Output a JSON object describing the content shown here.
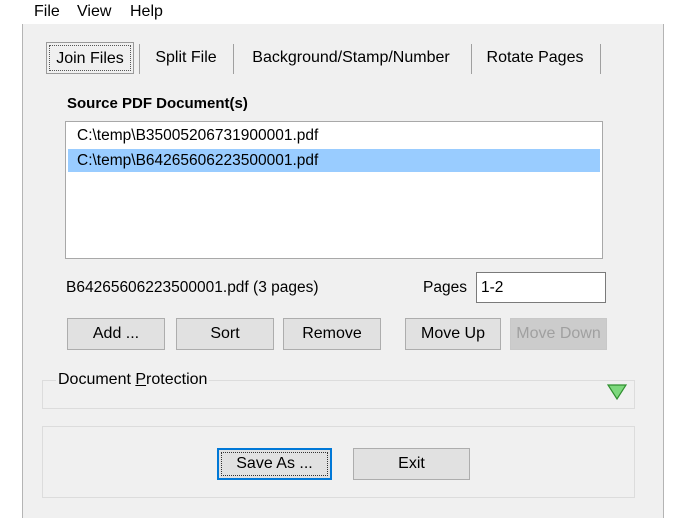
{
  "menubar": {
    "file": "File",
    "view": "View",
    "help": "Help"
  },
  "tabs": [
    {
      "label": "Join Files",
      "active": true
    },
    {
      "label": "Split File",
      "active": false
    },
    {
      "label": "Background/Stamp/Number",
      "active": false
    },
    {
      "label": "Rotate Pages",
      "active": false
    }
  ],
  "source": {
    "heading": "Source PDF Document(s)",
    "files": [
      {
        "path": "C:\\temp\\B35005206731900001.pdf",
        "selected": false
      },
      {
        "path": "C:\\temp\\B64265606223500001.pdf",
        "selected": true
      }
    ],
    "selected_info": "B64265606223500001.pdf  (3 pages)",
    "pages_label_pre": "Pa",
    "pages_label_accel": "g",
    "pages_label_post": "es",
    "pages_value": "1-2"
  },
  "buttons": {
    "add": "Add ...",
    "sort": "Sort",
    "remove": "Remove",
    "move_up": "Move Up",
    "move_down": "Move Down"
  },
  "protection": {
    "title_pre": "Document ",
    "title_accel": "P",
    "title_post": "rotection",
    "expand_icon": "triangle-down-green",
    "icon_color": "#7dd87d"
  },
  "footer": {
    "save_as": "Save As ...",
    "exit": "Exit"
  },
  "colors": {
    "selection": "#99ccff",
    "focus_border": "#0078d7"
  }
}
